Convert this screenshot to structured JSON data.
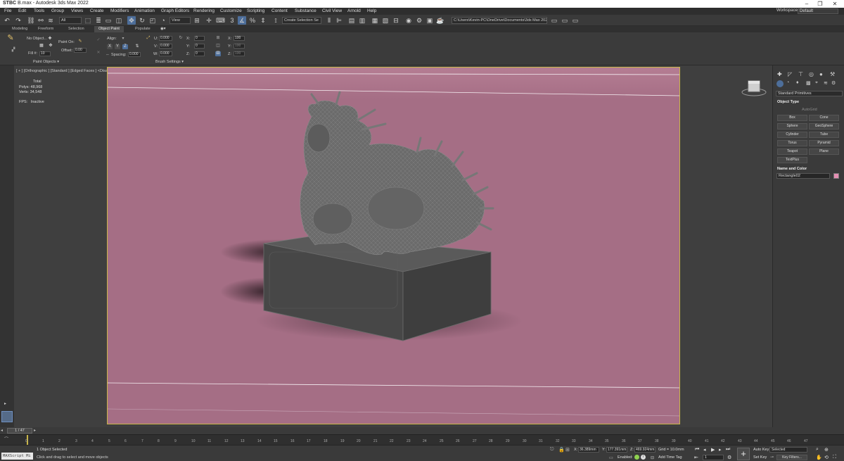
{
  "window": {
    "file_badge": "STBC",
    "title": "B.max - Autodesk 3ds Max 2022",
    "controls": [
      "–",
      "❐",
      "✕"
    ]
  },
  "menu": {
    "items": [
      "File",
      "Edit",
      "Tools",
      "Group",
      "Views",
      "Create",
      "Modifiers",
      "Animation",
      "Graph Editors",
      "Rendering",
      "Customize",
      "Scripting",
      "Content",
      "Substance",
      "Civil View",
      "Arnold",
      "Help"
    ],
    "workspaces_label": "Workspaces:",
    "workspaces_value": "Default"
  },
  "toolbar": {
    "selection_filter": "All",
    "view_dropdown": "View",
    "named_selection": "Create Selection Se",
    "project_path": "C:\\Users\\Kevin-PC\\OneDrive\\Documents\\3ds Max 2022"
  },
  "ribbon": {
    "tabs": [
      "Modeling",
      "Freeform",
      "Selection",
      "Object Paint",
      "Populate"
    ],
    "selected_tab": "Object Paint",
    "no_object": "No Object...",
    "fill_label": "Fill #:",
    "fill_value": "10",
    "paint_on": "Paint On:",
    "offset_label": "Offset:",
    "offset_value": "0.00",
    "align_label": "Align:",
    "axes": [
      "X",
      "Y",
      "Z"
    ],
    "spacing_label": "Spacing:",
    "spacing_value": "0.000",
    "u_label": "U:",
    "u_value": "0.000",
    "v_label": "V:",
    "v_value": "0.000",
    "w_label": "W:",
    "w_value": "0.000",
    "x_label": "X:",
    "x_value": "0",
    "y_label": "Y:",
    "y_value": "0",
    "z_label": "Z:",
    "z_value": "0",
    "sx_label": "X:",
    "sx_value": "100",
    "sy_label": "Y:",
    "sy_value": "100",
    "sz_label": "Z:",
    "sz_value": "100",
    "group_paint_objects": "Paint Objects ▾",
    "group_brush_settings": "Brush Settings ▾"
  },
  "viewport": {
    "label": "[ + ] [Orthographic ] [Standard ] [Edged Faces ]  <Disabled>",
    "stats_title": "Total",
    "polys_label": "Polys:",
    "polys_value": "48,968",
    "verts_label": "Verts:",
    "verts_value": "34,548",
    "fps_label": "FPS:",
    "fps_value": "Inactive",
    "background_color": "#a56e85",
    "frame_color": "#c9b548"
  },
  "command_panel": {
    "dropdown": "Standard Primitives",
    "object_type_header": "Object Type",
    "autogrid": "AutoGrid",
    "buttons": [
      "Box",
      "Cone",
      "Sphere",
      "GeoSphere",
      "Cylinder",
      "Tube",
      "Torus",
      "Pyramid",
      "Teapot",
      "Plane",
      "TextPlus"
    ],
    "name_color_header": "Name and Color",
    "object_name": "Rectangle02",
    "swatch_color": "#e58fb3"
  },
  "timeline": {
    "frame_display": "1 / 47",
    "ticks": [
      "0",
      "1",
      "2",
      "3",
      "4",
      "5",
      "6",
      "7",
      "8",
      "9",
      "10",
      "11",
      "12",
      "13",
      "14",
      "15",
      "16",
      "17",
      "18",
      "19",
      "20",
      "21",
      "22",
      "23",
      "24",
      "25",
      "26",
      "27",
      "28",
      "29",
      "30",
      "31",
      "32",
      "33",
      "34",
      "35",
      "36",
      "37",
      "38",
      "39",
      "40",
      "41",
      "42",
      "43",
      "44",
      "45",
      "46",
      "47"
    ]
  },
  "status": {
    "maxscript": "MAXScript Mi",
    "selection_msg": "1 Object Selected",
    "prompt_msg": "Click and drag to select and move objects",
    "x_label": "X:",
    "x_value": "36.389mm",
    "y_label": "Y:",
    "y_value": "177.391mm",
    "z_label": "Z:",
    "z_value": "469.924mm",
    "grid": "Grid = 10.0mm",
    "enabled_label": "Enabled:",
    "add_time_tag": "Add Time Tag",
    "frame_value": "1",
    "auto_key": "Auto Key",
    "set_key": "Set Key",
    "selected_dropdown": "Selected",
    "key_filters": "Key Filters..."
  }
}
